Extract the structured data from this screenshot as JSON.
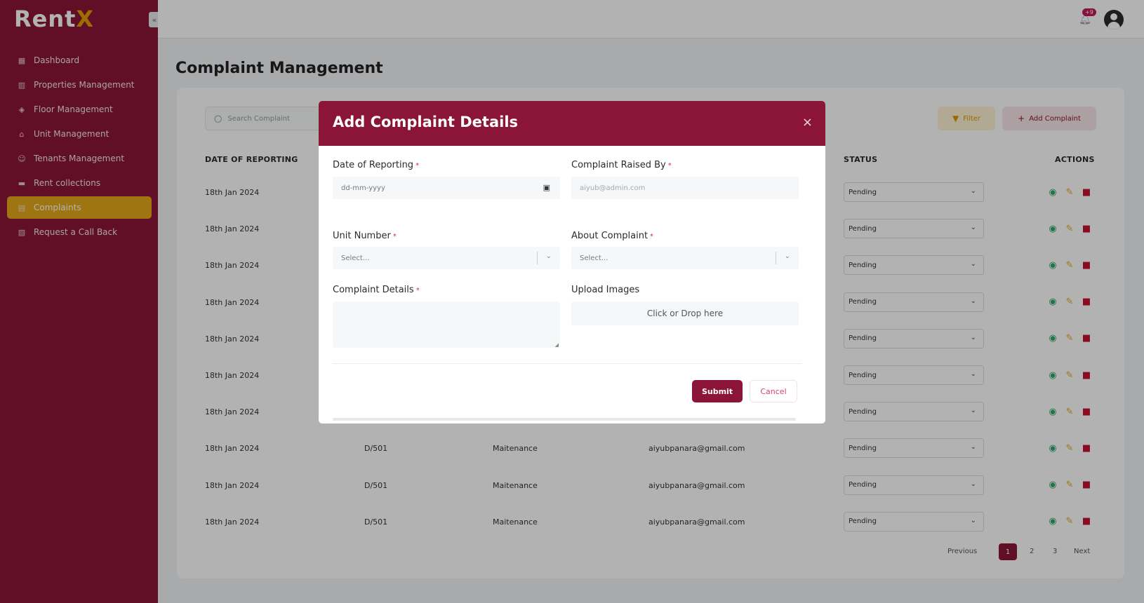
{
  "app": {
    "logo_main": "Rent",
    "logo_accent": "X",
    "collapse_glyph": "«"
  },
  "colors": {
    "brand": "#8b1538",
    "accent": "#e4a81a",
    "view": "#2fa66a",
    "delete": "#c8102e"
  },
  "sidebar": {
    "items": [
      {
        "label": "Dashboard",
        "icon": "dashboard-icon"
      },
      {
        "label": "Properties Management",
        "icon": "building-icon"
      },
      {
        "label": "Floor Management",
        "icon": "layers-icon"
      },
      {
        "label": "Unit Management",
        "icon": "home-icon"
      },
      {
        "label": "Tenants Management",
        "icon": "user-icon"
      },
      {
        "label": "Rent collections",
        "icon": "card-icon"
      },
      {
        "label": "Complaints",
        "icon": "document-icon",
        "active": true
      },
      {
        "label": "Request a Call Back",
        "icon": "phone-icon"
      }
    ]
  },
  "header": {
    "notification_count": "+9"
  },
  "page": {
    "title": "Complaint Management"
  },
  "toolbar": {
    "search_placeholder": "Search Complaint",
    "filter_label": "Filter",
    "add_label": "Add Complaint"
  },
  "table": {
    "headers": {
      "date": "DATE OF REPORTING",
      "status": "STATUS",
      "actions": "ACTIONS"
    },
    "rows": [
      {
        "date": "18th Jan 2024",
        "unit": "",
        "type": "",
        "email": "",
        "status": "Pending"
      },
      {
        "date": "18th Jan 2024",
        "unit": "",
        "type": "",
        "email": "",
        "status": "Pending"
      },
      {
        "date": "18th Jan 2024",
        "unit": "",
        "type": "",
        "email": "",
        "status": "Pending"
      },
      {
        "date": "18th Jan 2024",
        "unit": "",
        "type": "",
        "email": "",
        "status": "Pending"
      },
      {
        "date": "18th Jan 2024",
        "unit": "",
        "type": "",
        "email": "",
        "status": "Pending"
      },
      {
        "date": "18th Jan 2024",
        "unit": "",
        "type": "",
        "email": "",
        "status": "Pending"
      },
      {
        "date": "18th Jan 2024",
        "unit": "",
        "type": "",
        "email": "",
        "status": "Pending"
      },
      {
        "date": "18th Jan 2024",
        "unit": "D/501",
        "type": "Maitenance",
        "email": "aiyubpanara@gmail.com",
        "status": "Pending"
      },
      {
        "date": "18th Jan 2024",
        "unit": "D/501",
        "type": "Maitenance",
        "email": "aiyubpanara@gmail.com",
        "status": "Pending"
      },
      {
        "date": "18th Jan 2024",
        "unit": "D/501",
        "type": "Maitenance",
        "email": "aiyubpanara@gmail.com",
        "status": "Pending"
      }
    ]
  },
  "pagination": {
    "previous": "Previous",
    "pages": [
      "1",
      "2",
      "3"
    ],
    "current": "1",
    "next": "Next"
  },
  "modal": {
    "title": "Add Complaint Details",
    "close": "×",
    "date_label": "Date of Reporting",
    "date_placeholder": "dd-mm-yyyy",
    "raised_by_label": "Complaint Raised By",
    "raised_by_value": "aiyub@admin.com",
    "unit_label": "Unit Number",
    "unit_placeholder": "Select...",
    "about_label": "About Complaint",
    "about_placeholder": "Select...",
    "details_label": "Complaint Details",
    "upload_label": "Upload Images",
    "upload_text": "Click or Drop here",
    "submit": "Submit",
    "cancel": "Cancel",
    "required_mark": "*"
  }
}
